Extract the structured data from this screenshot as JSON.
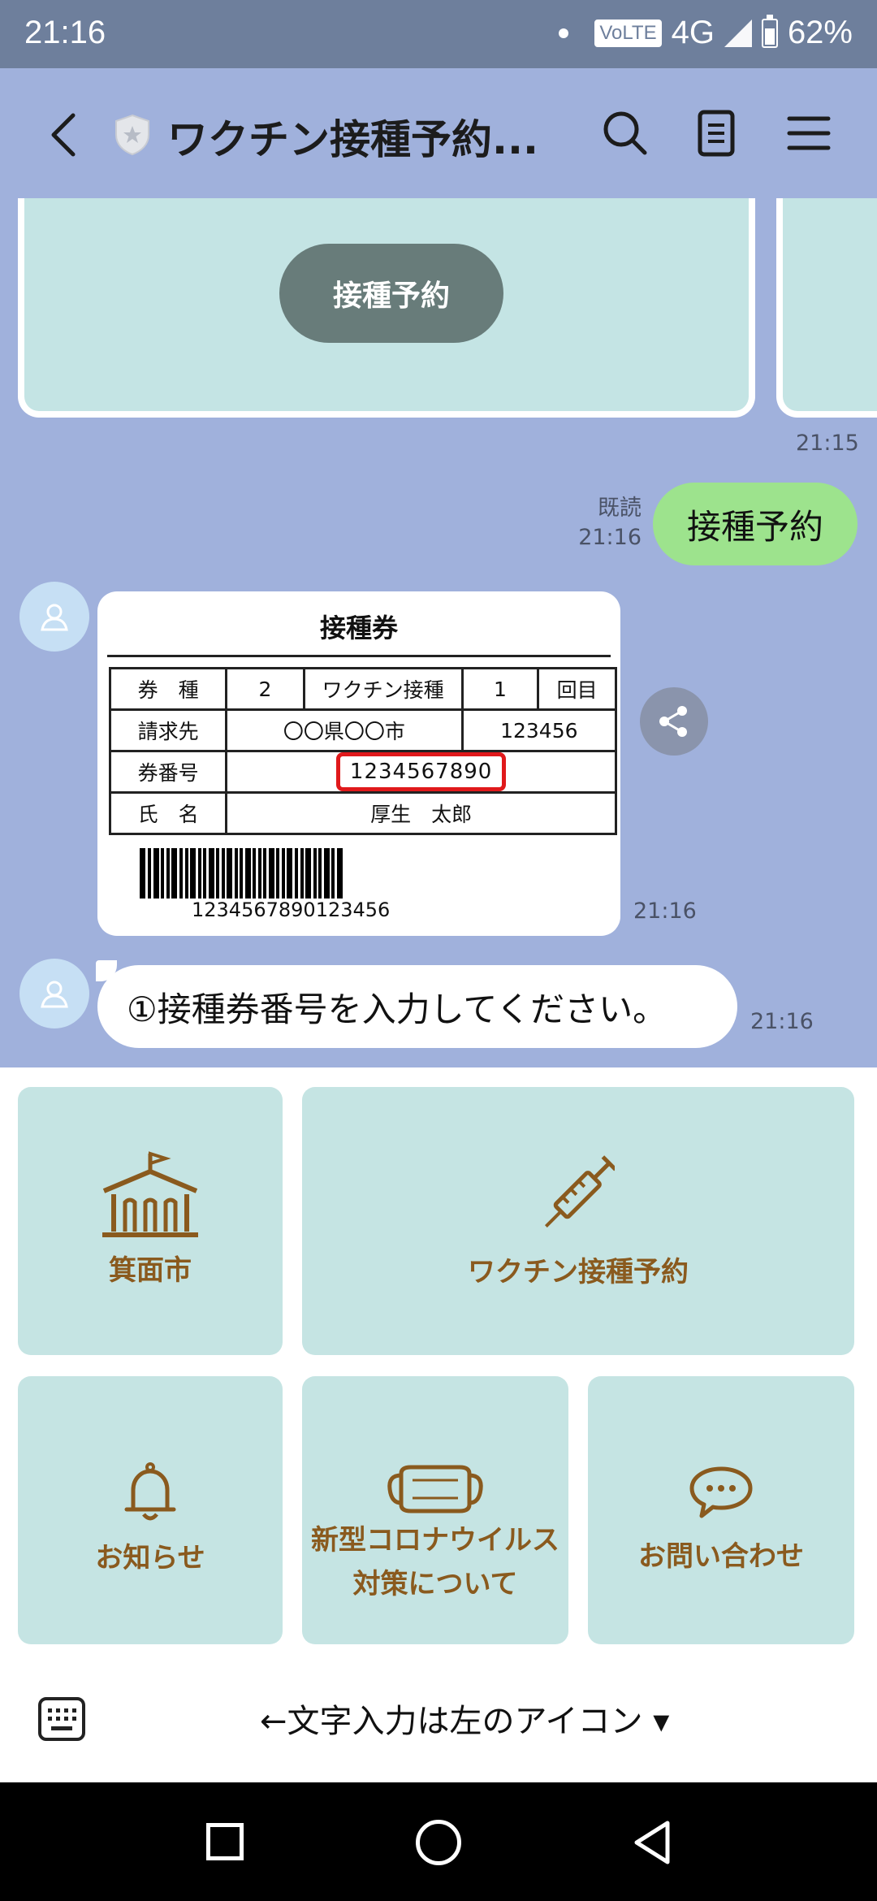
{
  "status_bar": {
    "time": "21:16",
    "volte": "VoLTE",
    "network": "4G",
    "battery": "62%"
  },
  "header": {
    "title": "ワクチン接種予約..."
  },
  "chat": {
    "card_button": "接種予約",
    "card_time": "21:15",
    "my_message": {
      "read_label": "既読",
      "time": "21:16",
      "text": "接種予約"
    },
    "ticket": {
      "title": "接種券",
      "row1": {
        "label": "券　種",
        "kind": "2",
        "vaccine": "ワクチン接種",
        "count": "1",
        "count_label": "回目"
      },
      "row2": {
        "label": "請求先",
        "city": "〇〇県〇〇市",
        "code": "123456"
      },
      "row3": {
        "label": "券番号",
        "number": "1234567890"
      },
      "row4": {
        "label": "氏　名",
        "name": "厚生　太郎"
      },
      "barcode_number": "1234567890123456",
      "time": "21:16"
    },
    "bot_message": {
      "text": "①接種券番号を入力してください。",
      "time": "21:16"
    }
  },
  "rich_menu": {
    "city": "箕面市",
    "vaccine": "ワクチン接種予約",
    "notice": "お知らせ",
    "corona_line1": "新型コロナウイルス",
    "corona_line2": "対策について",
    "inquiry": "お問い合わせ"
  },
  "input_bar": {
    "label": "←文字入力は左のアイコン ▾"
  },
  "colors": {
    "header_bg": "#a0b1dc",
    "menu_tile": "#c5e4e3",
    "menu_text": "#8a5a1e",
    "my_bubble": "#9de38d"
  }
}
